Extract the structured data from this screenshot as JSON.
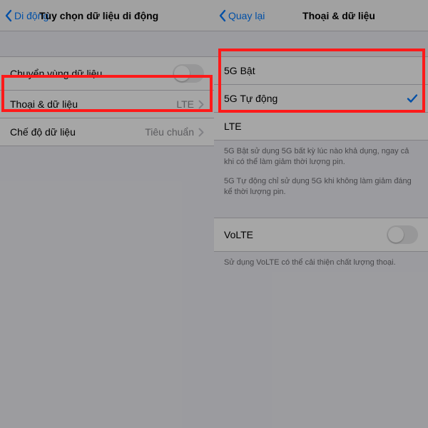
{
  "left": {
    "back_label": "Di động",
    "title": "Tùy chọn dữ liệu di động",
    "roaming_label": "Chuyển vùng dữ liệu",
    "voice_data_label": "Thoại & dữ liệu",
    "voice_data_value": "LTE",
    "data_mode_label": "Chế độ dữ liệu",
    "data_mode_value": "Tiêu chuẩn"
  },
  "right": {
    "back_label": "Quay lại",
    "title": "Thoại & dữ liệu",
    "opt_5g_on": "5G Bật",
    "opt_5g_auto": "5G Tự động",
    "opt_lte": "LTE",
    "note_5g_on": "5G Bật sử dụng 5G bất kỳ lúc nào khả dụng, ngay cả khi có thể làm giảm thời lượng pin.",
    "note_5g_auto": "5G Tự động chỉ sử dụng 5G khi không làm giảm đáng kể thời lượng pin.",
    "volte_label": "VoLTE",
    "volte_note": "Sử dụng VoLTE có thể cải thiện chất lượng thoại."
  }
}
